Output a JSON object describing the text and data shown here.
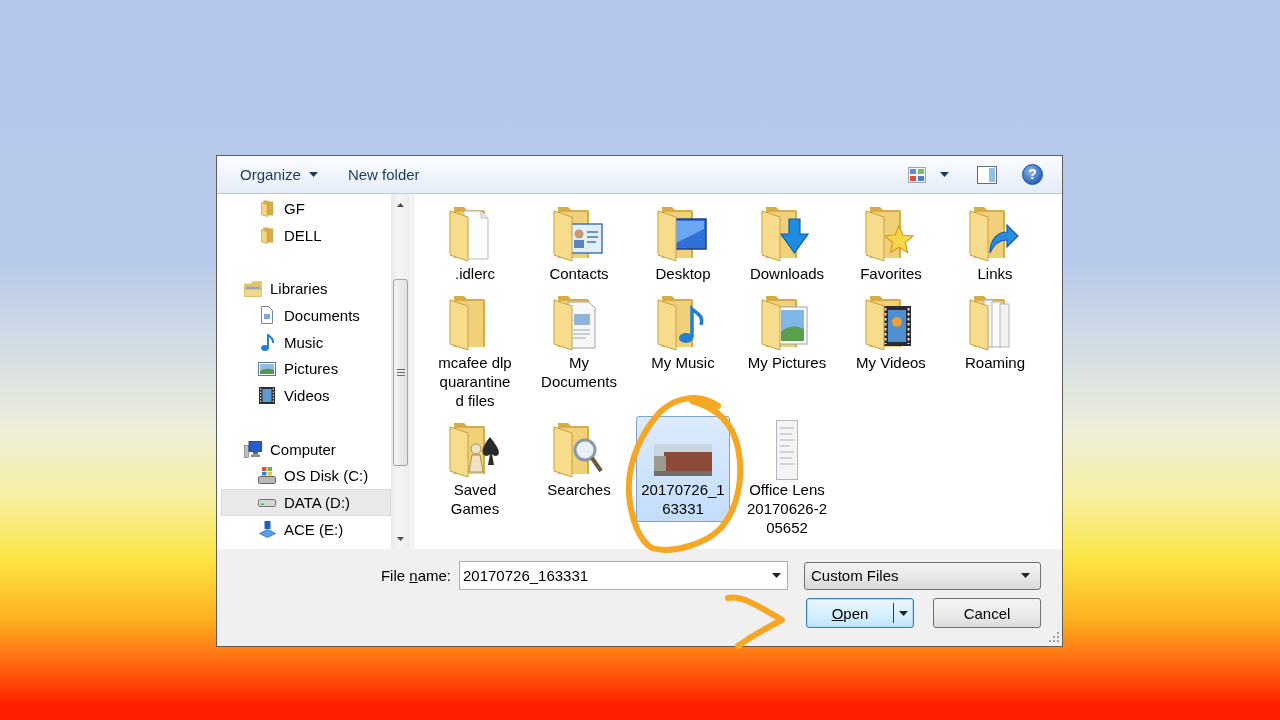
{
  "toolbar": {
    "buttons": [
      {
        "label": "Organize",
        "dropdown": true
      },
      {
        "label": "New folder",
        "dropdown": false
      }
    ],
    "help": "?"
  },
  "navigation": [
    {
      "children": [
        {
          "label": "GF",
          "kind": "folder",
          "selected": false
        },
        {
          "label": "DELL",
          "kind": "folder",
          "selected": false
        }
      ]
    },
    {
      "label": "Libraries",
      "kind": "library",
      "selected": false,
      "children": [
        {
          "label": "Documents",
          "kind": "documents",
          "selected": false
        },
        {
          "label": "Music",
          "kind": "music",
          "selected": false
        },
        {
          "label": "Pictures",
          "kind": "pictures",
          "selected": false
        },
        {
          "label": "Videos",
          "kind": "videos",
          "selected": false
        }
      ]
    },
    {
      "label": "Computer",
      "kind": "computer",
      "selected": false,
      "children": [
        {
          "label": "OS Disk (C:)",
          "kind": "system-drive",
          "selected": false
        },
        {
          "label": "DATA (D:)",
          "kind": "drive",
          "selected": true
        },
        {
          "label": "ACE (E:)",
          "kind": "device",
          "selected": false
        }
      ]
    }
  ],
  "files": [
    {
      "lines": [
        ".idlerc"
      ],
      "kind": "page-folder",
      "selected": false
    },
    {
      "lines": [
        "Contacts"
      ],
      "kind": "contact-folder",
      "selected": false
    },
    {
      "lines": [
        "Desktop"
      ],
      "kind": "monitor-folder",
      "selected": false
    },
    {
      "lines": [
        "Downloads"
      ],
      "kind": "arrow-folder",
      "selected": false
    },
    {
      "lines": [
        "Favorites"
      ],
      "kind": "star-folder",
      "selected": false
    },
    {
      "lines": [
        "Links"
      ],
      "kind": "link-folder",
      "selected": false
    },
    {
      "lines": [
        "mcafee dlp",
        "quarantine",
        "d files"
      ],
      "kind": "folder",
      "selected": false
    },
    {
      "lines": [
        "My",
        "Documents"
      ],
      "kind": "document-folder",
      "selected": false
    },
    {
      "lines": [
        "My Music"
      ],
      "kind": "music-folder",
      "selected": false
    },
    {
      "lines": [
        "My Pictures"
      ],
      "kind": "picture-folder",
      "selected": false
    },
    {
      "lines": [
        "My Videos"
      ],
      "kind": "film-folder",
      "selected": false
    },
    {
      "lines": [
        "Roaming"
      ],
      "kind": "papers-folder",
      "selected": false
    },
    {
      "lines": [
        "Saved",
        "Games"
      ],
      "kind": "game-folder",
      "selected": false
    },
    {
      "lines": [
        "Searches"
      ],
      "kind": "search-folder",
      "selected": false
    },
    {
      "lines": [
        "20170726_1",
        "63331"
      ],
      "kind": "photo",
      "selected": true
    },
    {
      "lines": [
        "Office Lens",
        "20170626-2",
        "05652"
      ],
      "kind": "document",
      "selected": false
    }
  ],
  "file_name": {
    "label": [
      {
        "text": "File ",
        "underlined": false
      },
      {
        "text": "n",
        "underlined": true
      },
      {
        "text": "ame:",
        "underlined": false
      }
    ],
    "value": "20170726_163331"
  },
  "file_type": {
    "value": "Custom Files"
  },
  "buttons": [
    {
      "kind": "split",
      "default": true,
      "label": [
        {
          "text": "O",
          "underlined": true
        },
        {
          "text": "pen",
          "underlined": false
        }
      ]
    },
    {
      "kind": "plain",
      "default": false,
      "label": [
        {
          "text": "Cancel",
          "underlined": false
        }
      ]
    }
  ]
}
